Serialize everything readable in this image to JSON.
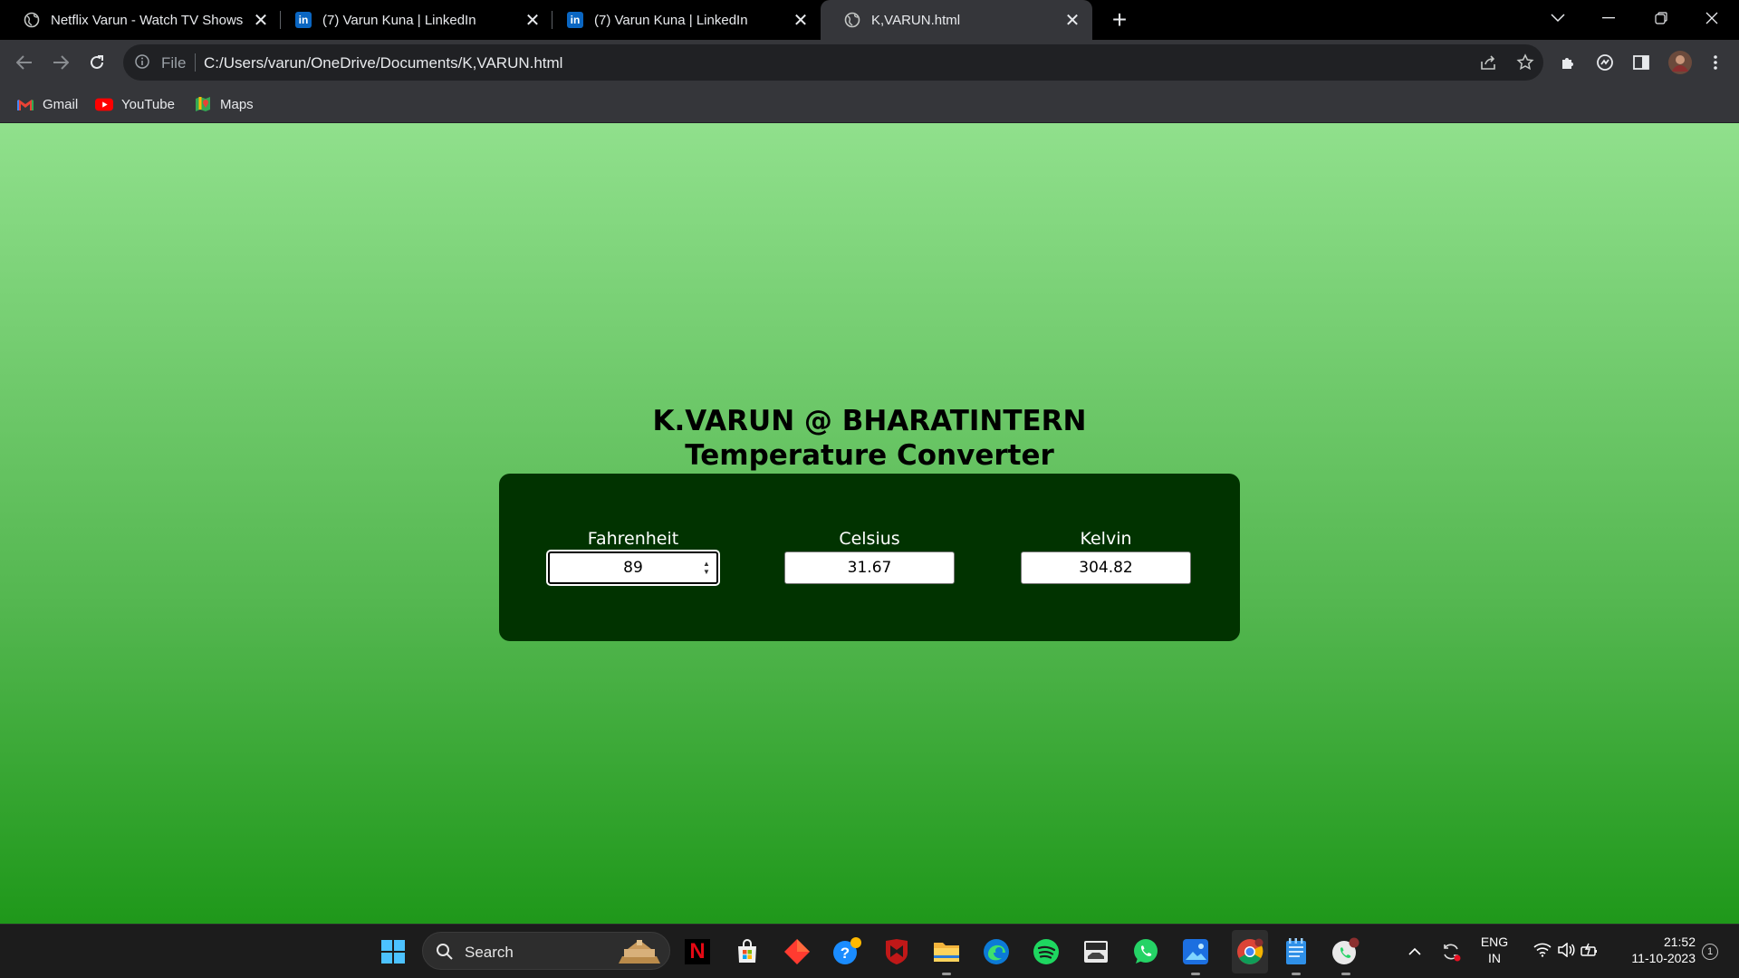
{
  "browser": {
    "tabs": [
      {
        "title": "Netflix Varun - Watch TV Shows",
        "icon": "globe-icon"
      },
      {
        "title": "(7) Varun Kuna | LinkedIn",
        "icon": "linkedin-icon"
      },
      {
        "title": "(7) Varun Kuna | LinkedIn",
        "icon": "linkedin-icon"
      },
      {
        "title": "K,VARUN.html",
        "icon": "globe-icon",
        "active": true
      }
    ],
    "linkedin_glyph": "in",
    "omnibox": {
      "scheme_label": "File",
      "url": "C:/Users/varun/OneDrive/Documents/K,VARUN.html"
    },
    "bookmarks": [
      {
        "label": "Gmail",
        "icon": "gmail-icon"
      },
      {
        "label": "YouTube",
        "icon": "youtube-icon"
      },
      {
        "label": "Maps",
        "icon": "maps-icon"
      }
    ]
  },
  "page": {
    "heading_line1": "K.VARUN @ BHARATINTERN",
    "heading_line2": "Temperature Converter",
    "fields": [
      {
        "label": "Fahrenheit",
        "value": "89",
        "focused": true
      },
      {
        "label": "Celsius",
        "value": "31.67"
      },
      {
        "label": "Kelvin",
        "value": "304.82"
      }
    ],
    "colors": {
      "card": "#013300",
      "gradient_top": "#90e08c",
      "gradient_bottom": "#1f981a"
    }
  },
  "taskbar": {
    "search_label": "Search",
    "netflix_glyph": "N",
    "lang_line1": "ENG",
    "lang_line2": "IN",
    "time": "21:52",
    "date": "11-10-2023",
    "notification_count": "1"
  }
}
